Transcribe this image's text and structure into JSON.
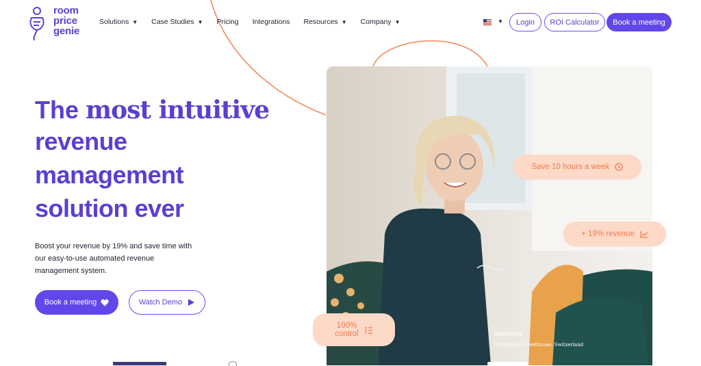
{
  "brand": {
    "logo_lines": [
      "room",
      "price",
      "genie"
    ]
  },
  "nav": [
    {
      "label": "Solutions",
      "has_dropdown": true
    },
    {
      "label": "Case Studies",
      "has_dropdown": true
    },
    {
      "label": "Pricing",
      "has_dropdown": false
    },
    {
      "label": "Integrations",
      "has_dropdown": false
    },
    {
      "label": "Resources",
      "has_dropdown": true
    },
    {
      "label": "Company",
      "has_dropdown": true
    }
  ],
  "header_actions": {
    "language_icon": "us-flag-icon",
    "login_label": "Login",
    "roi_label": "ROI Calculator",
    "book_label": "Book a meeting"
  },
  "hero": {
    "title_word1": "The",
    "title_word2": "most intuitive",
    "title_line2": "revenue",
    "title_line3": "management",
    "title_line4": "solution ever",
    "subtitle": "Boost your revenue by 19% and save time with our easy-to-use automated revenue management system.",
    "book_button": "Book a meeting",
    "book_icon": "heart-icon",
    "watch_button": "Watch Demo",
    "watch_icon": "play-icon"
  },
  "photo_badges": {
    "save_time": {
      "label": "Save 10 hours a week",
      "icon": "clock-icon"
    },
    "revenue": {
      "label": "+ 19% revenue",
      "icon": "chart-icon"
    },
    "control": {
      "line1": "100%",
      "line2": "control",
      "icon": "list-icon"
    }
  },
  "testimonial": {
    "name": "Valentina",
    "place": "Wanderlust Guesthouse, Switzerland"
  },
  "colors": {
    "brand_purple": "#6246ea",
    "accent_orange": "#f17a4e",
    "badge_peach": "#fdd9c8"
  }
}
